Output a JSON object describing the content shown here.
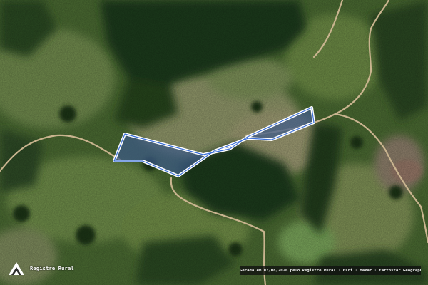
{
  "map": {
    "basemap": "satellite",
    "parcel": {
      "fill": "#3c5a8a",
      "fill_opacity": 0.7,
      "outline_color": "#ffffff",
      "inner_outline_color": "#3a6fd8"
    },
    "road_color": "#c9b48f"
  },
  "branding": {
    "logo_icon": "registre-rural-logo",
    "name": "Registre Rural"
  },
  "attribution": {
    "text": "Gerada em 07/08/2026 pelo Registre Rural · Esri · Maxar · Earthstar Geographics"
  }
}
